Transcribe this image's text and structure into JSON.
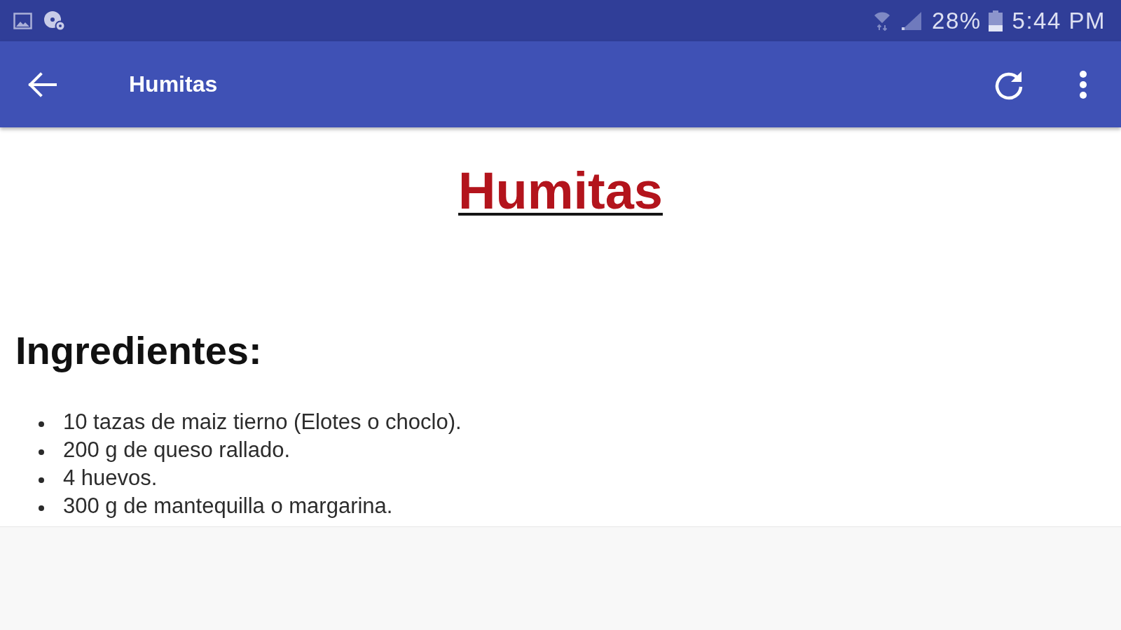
{
  "status_bar": {
    "battery_percent": "28%",
    "time": "5:44 PM"
  },
  "app_bar": {
    "title": "Humitas"
  },
  "article": {
    "title": "Humitas",
    "heading": "Ingredientes:",
    "ingredients": [
      "10 tazas de maiz tierno (Elotes o choclo).",
      "200 g de queso rallado.",
      "4 huevos.",
      "300 g de mantequilla o margarina."
    ]
  }
}
